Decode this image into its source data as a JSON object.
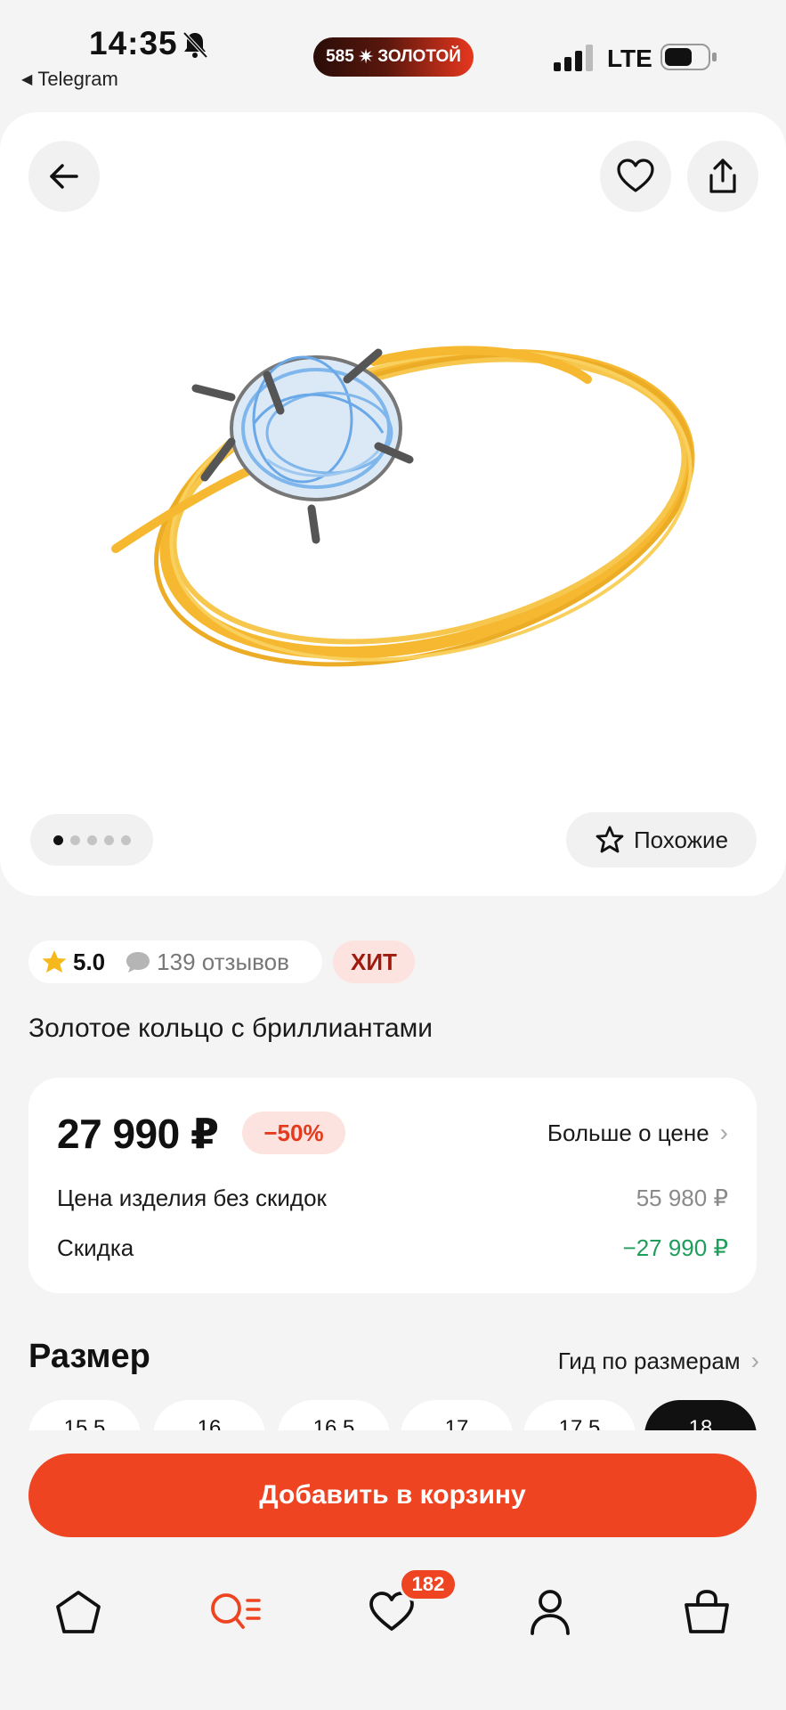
{
  "status_bar": {
    "time": "14:35",
    "back_app": "Telegram",
    "brand": {
      "number": "585",
      "spark": "✷",
      "name": "ЗОЛОТОЙ"
    },
    "network": "LTE"
  },
  "product": {
    "image_alt": "Золотое кольцо с бриллиантами",
    "gallery": {
      "total": 5,
      "active": 1
    },
    "similar_label": "Похожие",
    "rating": "5.0",
    "reviews": "139 отзывов",
    "badge": "ХИТ",
    "title": "Золотое кольцо с бриллиантами"
  },
  "price": {
    "current": "27 990 ₽",
    "discount_badge": "−50%",
    "more_label": "Больше о цене",
    "rows": [
      {
        "label": "Цена изделия без скидок",
        "value": "55 980 ₽"
      },
      {
        "label": "Скидка",
        "value": "−27 990 ₽"
      }
    ]
  },
  "sizes": {
    "title": "Размер",
    "guide_label": "Гид по размерам",
    "options": [
      "15,5",
      "16",
      "16,5",
      "17",
      "17,5",
      "18"
    ]
  },
  "cart": {
    "add_label": "Добавить в корзину"
  },
  "nav": {
    "favorites_count": "182"
  },
  "colors": {
    "accent": "#ee4422",
    "badge_bg": "#fde3df",
    "saving_green": "#1f9d5a",
    "gold": "#f4b11a",
    "gem_blue": "#7fb6ec"
  }
}
